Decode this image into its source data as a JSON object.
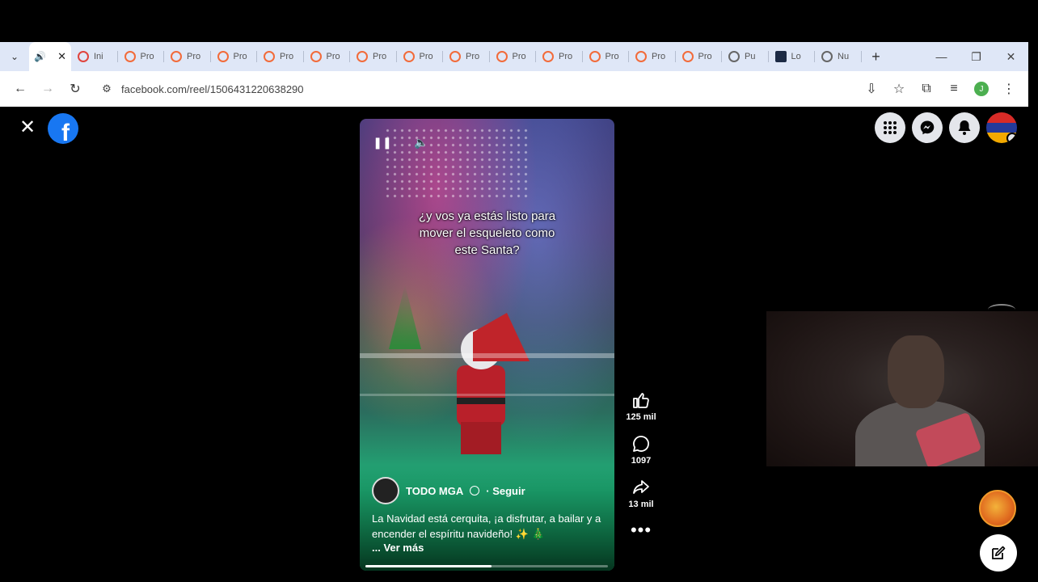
{
  "browser": {
    "tabs": [
      {
        "title": "",
        "state": "active",
        "icon": "speaker-icon"
      },
      {
        "title": "Ini",
        "icon": "red-round-favicon"
      },
      {
        "title": "Pro",
        "icon": "orange-favicon"
      },
      {
        "title": "Pro",
        "icon": "orange-favicon"
      },
      {
        "title": "Pro",
        "icon": "orange-favicon"
      },
      {
        "title": "Pro",
        "icon": "orange-favicon"
      },
      {
        "title": "Pro",
        "icon": "orange-favicon"
      },
      {
        "title": "Pro",
        "icon": "orange-favicon"
      },
      {
        "title": "Pro",
        "icon": "orange-favicon"
      },
      {
        "title": "Pro",
        "icon": "orange-favicon"
      },
      {
        "title": "Pro",
        "icon": "orange-favicon"
      },
      {
        "title": "Pro",
        "icon": "orange-favicon"
      },
      {
        "title": "Pro",
        "icon": "orange-favicon"
      },
      {
        "title": "Pro",
        "icon": "orange-favicon"
      },
      {
        "title": "Pro",
        "icon": "orange-favicon"
      },
      {
        "title": "Pu",
        "icon": "gray-favicon"
      },
      {
        "title": "Lo",
        "icon": "dark-square-favicon"
      },
      {
        "title": "Nu",
        "icon": "globe-favicon"
      }
    ],
    "url": "facebook.com/reel/1506431220638290",
    "profile_initial": "J"
  },
  "reel": {
    "caption_lines": [
      "¿y vos ya estás listo para",
      "mover el esqueleto como",
      "este Santa?"
    ],
    "author": "TODO MGA",
    "follow_label": "· Seguir",
    "description": "La Navidad está cerquita, ¡a disfrutar, a bailar y a encender el espíritu navideño! ✨ 🎄",
    "see_more": "... Ver más",
    "progress": 0.52
  },
  "actions": {
    "likes": "125 mil",
    "comments": "1097",
    "shares": "13 mil"
  },
  "colors": {
    "facebook_blue": "#1877f2",
    "tab_strip": "#dfe7f7",
    "tab_favicon": "#f26b3a"
  }
}
